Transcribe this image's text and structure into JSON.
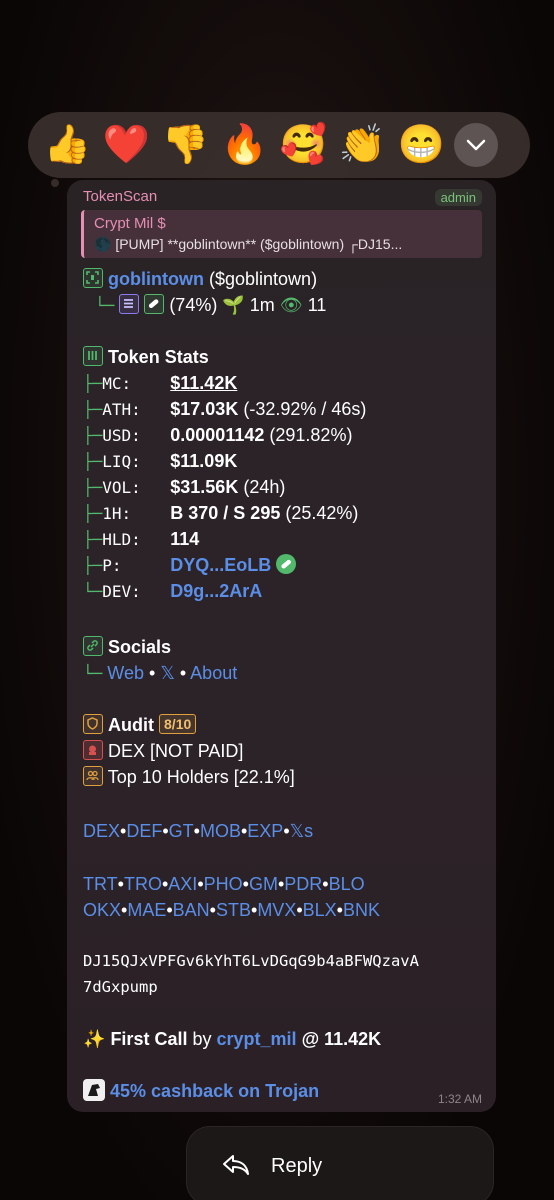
{
  "reactions": [
    {
      "emoji": "👍",
      "icon": "thumbs-up"
    },
    {
      "emoji": "❤️",
      "icon": "red-heart"
    },
    {
      "emoji": "👎",
      "icon": "thumbs-down"
    },
    {
      "emoji": "🔥",
      "icon": "fire"
    },
    {
      "emoji": "🥰",
      "icon": "smiling-face-with-hearts"
    },
    {
      "emoji": "👏",
      "icon": "clapping-hands"
    },
    {
      "emoji": "😁",
      "icon": "beaming-face"
    }
  ],
  "message": {
    "sender": "TokenScan",
    "role_badge": "admin",
    "reply": {
      "title": "Crypt Mil $",
      "text": "🌑 [PUMP] **goblintown** ($goblintown) ┌DJ15..."
    },
    "token": {
      "name": "goblintown",
      "ticker": "($goblintown)",
      "percent": "(74%)",
      "age": "1m",
      "views": "11"
    },
    "stats": {
      "heading": "Token Stats",
      "rows": [
        {
          "label": "MC:",
          "value": "$11.42K",
          "extra": ""
        },
        {
          "label": "ATH:",
          "value": "$17.03K",
          "extra": "(-32.92% / 46s)"
        },
        {
          "label": "USD:",
          "value": "0.00001142",
          "extra": "(291.82%)"
        },
        {
          "label": "LIQ:",
          "value": "$11.09K",
          "extra": ""
        },
        {
          "label": "VOL:",
          "value": "$31.56K",
          "extra": "(24h)"
        },
        {
          "label": "1H:",
          "value": "B 370 / S 295",
          "extra": "(25.42%)"
        },
        {
          "label": "HLD:",
          "value": "114",
          "extra": ""
        },
        {
          "label": "P:",
          "value": "DYQ...EoLB",
          "extra": ""
        },
        {
          "label": "DEV:",
          "value": "D9g...2ArA",
          "extra": ""
        }
      ]
    },
    "socials": {
      "heading": "Socials",
      "links": [
        "Web",
        "𝕏",
        "About"
      ],
      "separator": "•"
    },
    "audit": {
      "heading": "Audit",
      "score": "8/10",
      "dex": "DEX [NOT PAID]",
      "holders": "Top 10 Holders [22.1%]"
    },
    "links_row1": [
      "DEX",
      "DEF",
      "GT",
      "MOB",
      "EXP",
      "𝕏s"
    ],
    "links_row2": [
      "TRT",
      "TRO",
      "AXI",
      "PHO",
      "GM",
      "PDR",
      "BLO"
    ],
    "links_row3": [
      "OKX",
      "MAE",
      "BAN",
      "STB",
      "MVX",
      "BLX",
      "BNK"
    ],
    "address_line1": "DJ15QJxVPFGv6kYhT6LvDGqG9b4aBFWQzavA",
    "address_line2": "7dGxpump",
    "first_call": {
      "sparkle": "✨",
      "label": "First Call",
      "by": "by",
      "user": "crypt_mil",
      "at": "@ 11.42K"
    },
    "cashback": "45% cashback on Trojan",
    "time": "1:32 AM"
  },
  "reply_button": {
    "label": "Reply"
  },
  "colors": {
    "link": "#5b8ee6",
    "tree": "#52b86b",
    "sender": "#e58fb3",
    "audit": "#e0a040"
  }
}
